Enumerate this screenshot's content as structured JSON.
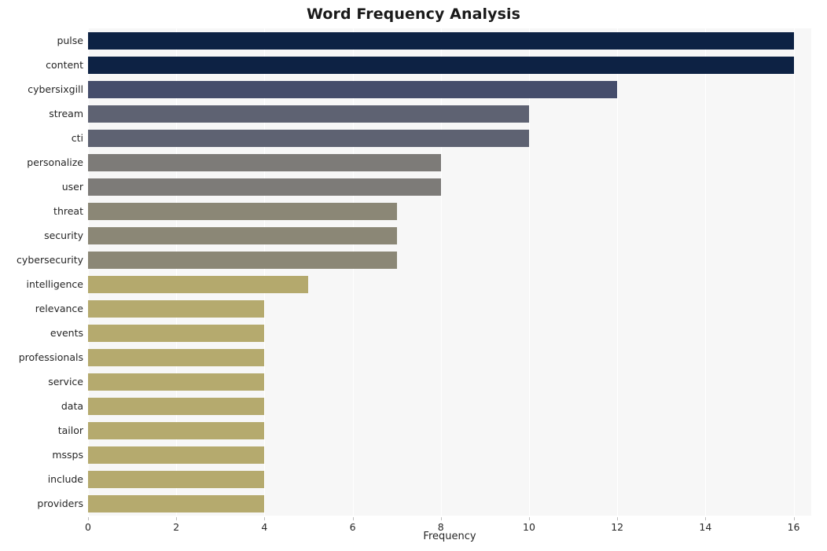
{
  "chart_data": {
    "type": "bar",
    "orientation": "horizontal",
    "title": "Word Frequency Analysis",
    "xlabel": "Frequency",
    "ylabel": "",
    "xlim": [
      0,
      16.4
    ],
    "xticks": [
      0,
      2,
      4,
      6,
      8,
      10,
      12,
      14,
      16
    ],
    "xtick_labels": [
      "0",
      "2",
      "4",
      "6",
      "8",
      "10",
      "12",
      "14",
      "16"
    ],
    "grid": true,
    "grid_axis": "x",
    "legend": null,
    "plot_background": "#f7f7f7",
    "categories": [
      "pulse",
      "content",
      "cybersixgill",
      "stream",
      "cti",
      "personalize",
      "user",
      "threat",
      "security",
      "cybersecurity",
      "intelligence",
      "relevance",
      "events",
      "professionals",
      "service",
      "data",
      "tailor",
      "mssps",
      "include",
      "providers"
    ],
    "values": [
      16,
      16,
      12,
      10,
      10,
      8,
      8,
      7,
      7,
      7,
      5,
      4,
      4,
      4,
      4,
      4,
      4,
      4,
      4,
      4
    ],
    "bar_colors": [
      "#0d2244",
      "#0d2244",
      "#454d6b",
      "#5e6272",
      "#5e6272",
      "#7d7b78",
      "#7d7b78",
      "#8b8776",
      "#8b8776",
      "#8b8776",
      "#b4a96d",
      "#b5aa6e",
      "#b5aa6e",
      "#b5aa6e",
      "#b5aa6e",
      "#b5aa6e",
      "#b5aa6e",
      "#b5aa6e",
      "#b5aa6e",
      "#b5aa6e"
    ]
  }
}
